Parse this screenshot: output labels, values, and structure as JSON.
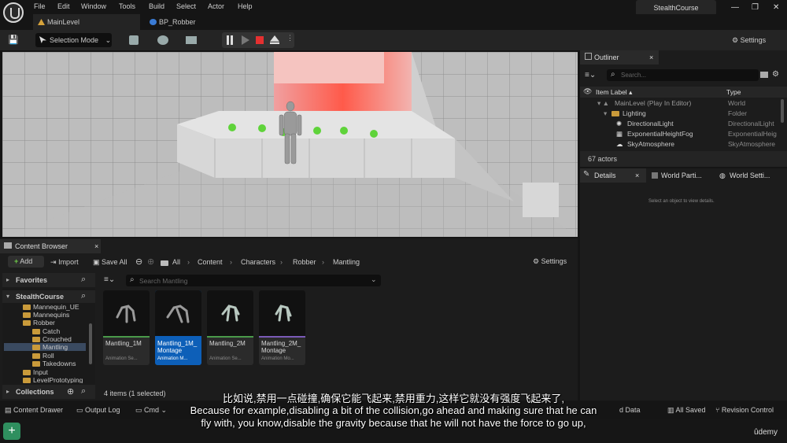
{
  "menu": {
    "items": [
      "File",
      "Edit",
      "Window",
      "Tools",
      "Build",
      "Select",
      "Actor",
      "Help"
    ],
    "project": "StealthCourse"
  },
  "tabs": [
    {
      "label": "MainLevel"
    },
    {
      "label": "BP_Robber"
    }
  ],
  "toolbar": {
    "selection_mode": "Selection Mode",
    "settings": "Settings"
  },
  "outliner": {
    "title": "Outliner",
    "search_placeholder": "Search...",
    "col_item": "Item Label",
    "col_type": "Type",
    "rows": [
      {
        "name": "MainLevel (Play In Editor)",
        "type": "World"
      },
      {
        "name": "Lighting",
        "type": "Folder"
      },
      {
        "name": "DirectionalLight",
        "type": "DirectionalLight"
      },
      {
        "name": "ExponentialHeightFog",
        "type": "ExponentialHeig"
      },
      {
        "name": "SkyAtmosphere",
        "type": "SkyAtmosphere"
      }
    ],
    "count": "67 actors"
  },
  "details": {
    "tab_details": "Details",
    "tab_world_partition": "World Parti...",
    "tab_world_settings": "World Setti...",
    "empty_message": "Select an object to view details."
  },
  "content_browser": {
    "title": "Content Browser",
    "add": "Add",
    "import": "Import",
    "save_all": "Save All",
    "breadcrumb": [
      "All",
      "Content",
      "Characters",
      "Robber",
      "Mantling"
    ],
    "settings": "Settings",
    "favorites": "Favorites",
    "project": "StealthCourse",
    "search_placeholder": "Search Mantling",
    "tree": [
      "Mannequin_UE",
      "Mannequins",
      "Robber",
      "Catch",
      "Crouched",
      "Mantling",
      "Roll",
      "Takedowns",
      "Input",
      "LevelPrototyping"
    ],
    "collections": "Collections",
    "assets": [
      {
        "name": "Mantling_1M",
        "type": "Animation Se..."
      },
      {
        "name": "Mantling_1M_",
        "name2": "Montage",
        "type": "Animation M..."
      },
      {
        "name": "Mantling_2M",
        "type": "Animation Se..."
      },
      {
        "name": "Mantling_2M_",
        "name2": "Montage",
        "type": "Animation Mo..."
      }
    ],
    "selection_status": "4 items (1 selected)"
  },
  "statusbar": {
    "content_drawer": "Content Drawer",
    "output_log": "Output Log",
    "cmd": "Cmd",
    "unsaved": "d Data",
    "all_saved": "All Saved",
    "revision_control": "Revision Control"
  },
  "subtitles": {
    "chinese": "比如说,禁用一点碰撞,确保它能飞起来,禁用重力,这样它就没有强度飞起来了,",
    "english_line1": "Because for example,disabling a bit of the collision,go ahead and making sure that he can",
    "english_line2": "fly with, you know,disable the gravity because that he will not have the force to go up,"
  },
  "watermark": "ûdemy"
}
